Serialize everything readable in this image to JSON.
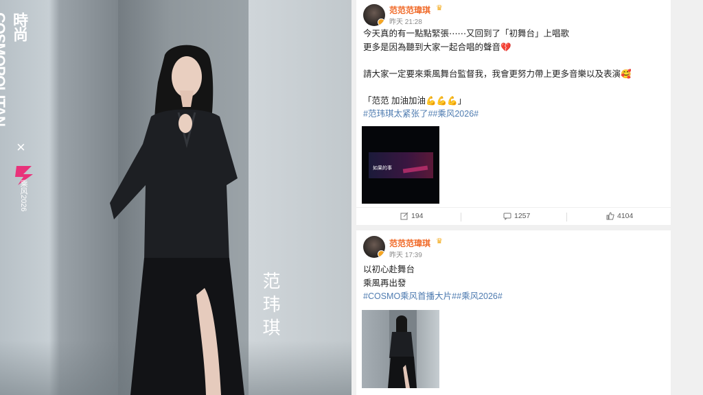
{
  "photo": {
    "magazine": "時尚COSMOPOLITAN",
    "cross": "×",
    "show_logo": "乘风2026",
    "artist": "范玮琪"
  },
  "posts": [
    {
      "user": "范范范瑋琪",
      "time": "昨天 21:28",
      "lines": [
        "今天真的有一點點緊張⋯⋯又回到了「初舞台」上唱歌",
        "更多是因為聽到大家一起合唱的聲音💔",
        "",
        "請大家一定要來乘風舞台監督我，我會更努力帶上更多音樂以及表演🥰",
        "",
        "「范范 加油加油💪💪💪」"
      ],
      "hashtags": "#范玮琪太紧张了##乘风2026#",
      "video_caption": "如果的事",
      "reposts": "194",
      "comments": "1257",
      "likes": "4104"
    },
    {
      "user": "范范范瑋琪",
      "time": "昨天 17:39",
      "lines": [
        "以初心赴舞台",
        "乘風再出發"
      ],
      "hashtags": "#COSMO乘风首播大片##乘风2026#"
    }
  ],
  "colors": {
    "username": "#f06a28",
    "hashtag": "#4e7bb0",
    "badge": "#f6a623"
  }
}
